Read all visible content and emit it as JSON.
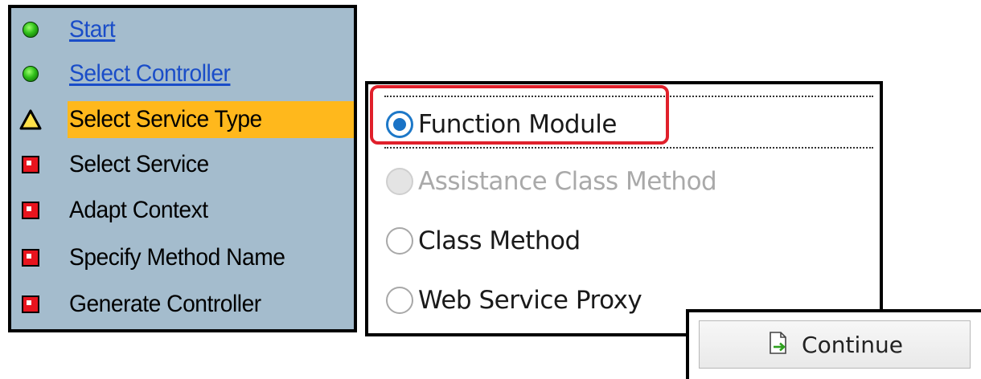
{
  "wizard": {
    "steps": [
      {
        "label": "Start",
        "status": "done",
        "icon": "green-dot-icon",
        "link": true
      },
      {
        "label": "Select Controller",
        "status": "done",
        "icon": "green-dot-icon",
        "link": true
      },
      {
        "label": "Select Service Type",
        "status": "current",
        "icon": "warning-triangle-icon",
        "link": false
      },
      {
        "label": "Select Service",
        "status": "pending",
        "icon": "red-square-icon",
        "link": false
      },
      {
        "label": "Adapt Context",
        "status": "pending",
        "icon": "red-square-icon",
        "link": false
      },
      {
        "label": "Specify Method Name",
        "status": "pending",
        "icon": "red-square-icon",
        "link": false
      },
      {
        "label": "Generate Controller",
        "status": "pending",
        "icon": "red-square-icon",
        "link": false
      }
    ]
  },
  "service_type": {
    "options": [
      {
        "label": "Function Module",
        "selected": true,
        "disabled": false
      },
      {
        "label": "Assistance Class Method",
        "selected": false,
        "disabled": true
      },
      {
        "label": "Class Method",
        "selected": false,
        "disabled": false
      },
      {
        "label": "Web Service Proxy",
        "selected": false,
        "disabled": false
      }
    ]
  },
  "footer": {
    "continue_label": "Continue",
    "continue_icon": "continue-doc-arrow-icon"
  },
  "colors": {
    "wizard_bg": "#a4bccd",
    "current_highlight": "#ffb81c",
    "link": "#1a4dc8",
    "radio_selected": "#1a73c6",
    "callout_border": "#e0202b"
  }
}
